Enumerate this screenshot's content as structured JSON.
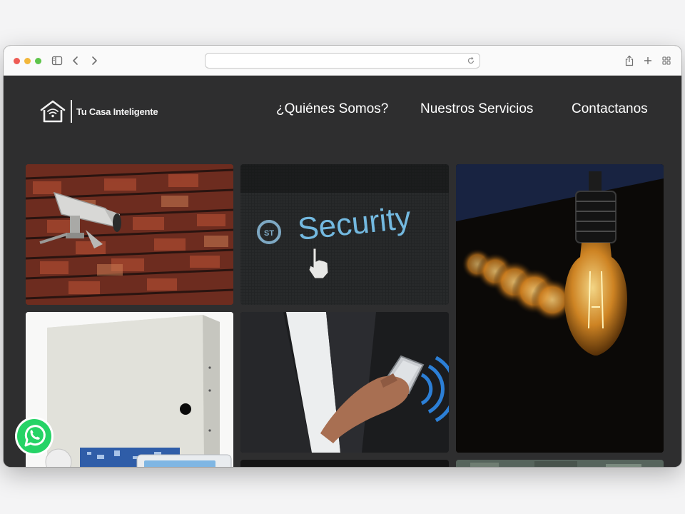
{
  "browser": {
    "url": "",
    "icons": [
      "sidebar-icon",
      "back-icon",
      "forward-icon",
      "reload-icon",
      "share-icon",
      "new-tab-icon",
      "tab-overview-icon"
    ]
  },
  "site": {
    "logo_text": "Tu Casa Inteligente",
    "nav": [
      {
        "label": "¿Quiénes Somos?"
      },
      {
        "label": "Nuestros Servicios"
      },
      {
        "label": "Contactanos"
      }
    ],
    "gallery": {
      "tiles": [
        {
          "subject": "security-camera-on-brick-wall"
        },
        {
          "subject": "security-screen-with-pointer",
          "caption": "Security"
        },
        {
          "subject": "light-bulbs"
        },
        {
          "subject": "alarm-control-panel"
        },
        {
          "subject": "person-using-smartphone"
        },
        {
          "subject": "dark-image-partial"
        },
        {
          "subject": "outdoor-image-partial"
        }
      ]
    },
    "whatsapp": {
      "icon": "whatsapp-icon",
      "color": "#25d366"
    }
  },
  "colors": {
    "page_background": "#2e2e2f",
    "nav_text": "#ffffff"
  }
}
